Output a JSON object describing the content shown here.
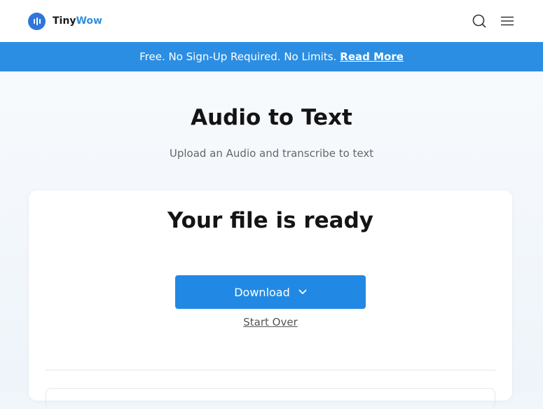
{
  "header": {
    "logo_text_dark": "Tiny",
    "logo_text_accent": "Wow",
    "icons": [
      "search-icon",
      "menu-icon"
    ],
    "brand_color": "#2f76d8"
  },
  "banner": {
    "text": "Free. No Sign-Up Required. No Limits.",
    "link": "Read More",
    "color": "#2b8ee3"
  },
  "main": {
    "title": "Audio to Text",
    "subtitle": "Upload an Audio and transcribe to text"
  },
  "result_card": {
    "title": "Your file is ready",
    "download_label": "Download",
    "start_over_label": "Start Over",
    "button_color": "#2189e4"
  }
}
